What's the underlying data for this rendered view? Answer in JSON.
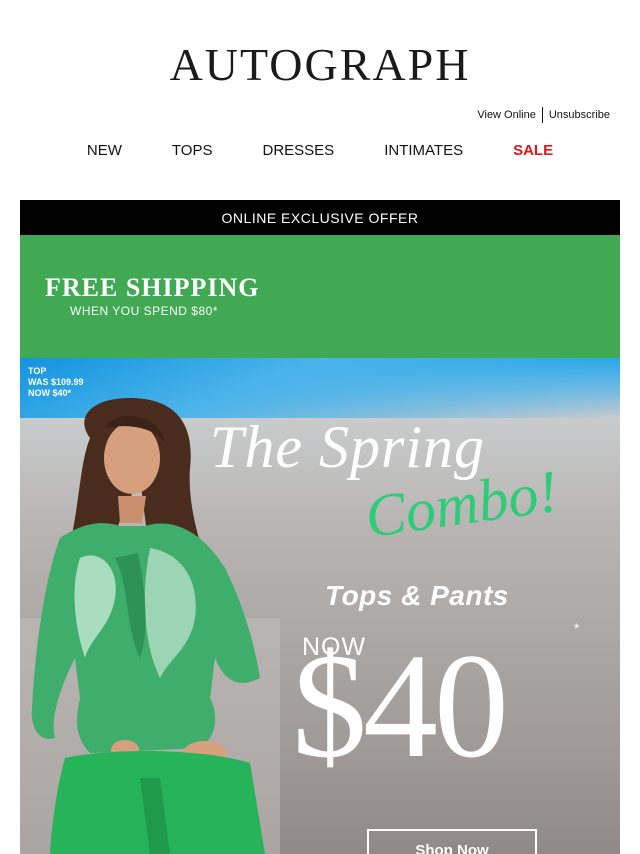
{
  "header": {
    "logo": "AUTOGRAPH",
    "view_online": "View Online",
    "unsubscribe": "Unsubscribe"
  },
  "nav": {
    "items": [
      "NEW",
      "TOPS",
      "DRESSES",
      "INTIMATES",
      "SALE"
    ]
  },
  "offer": {
    "banner": "ONLINE EXCLUSIVE OFFER",
    "free_shipping_title": "FREE SHIPPING",
    "free_shipping_sub": "WHEN YOU SPEND $80*"
  },
  "hero": {
    "price_note_1": "TOP",
    "price_note_2": "WAS $109.99",
    "price_note_3": "NOW $40*",
    "title_line1": "The Spring",
    "title_line2": "Combo!",
    "subtitle": "Tops & Pants",
    "now_label": "NOW",
    "price": "$40",
    "asterisk": "*",
    "cta": "Shop Now"
  },
  "colors": {
    "sale": "#e0161c",
    "banner_green": "#41a953",
    "combo_green": "#2ecc78"
  }
}
